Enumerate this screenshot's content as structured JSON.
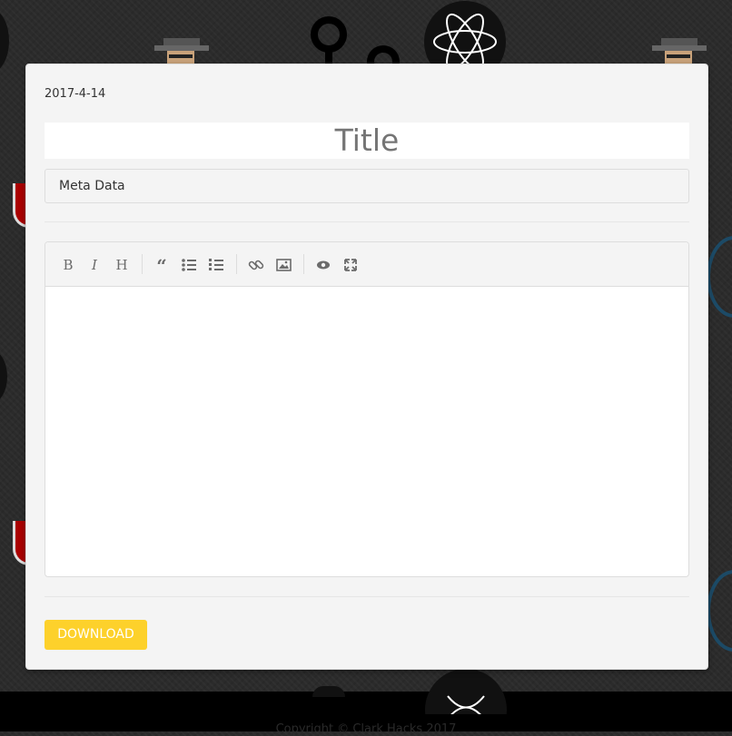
{
  "card": {
    "date": "2017-4-14",
    "title_placeholder": "Title",
    "meta_placeholder": "Meta Data",
    "download_label": "DOWNLOAD"
  },
  "toolbar": {
    "bold": "B",
    "italic": "I",
    "heading": "H"
  },
  "footer": {
    "text": "Copyright © Clark Hacks 2017"
  },
  "colors": {
    "accent": "#fdd12b",
    "card_bg": "#f4f4f4",
    "page_bg": "#2b2b2b",
    "footer_bg": "#000000"
  }
}
